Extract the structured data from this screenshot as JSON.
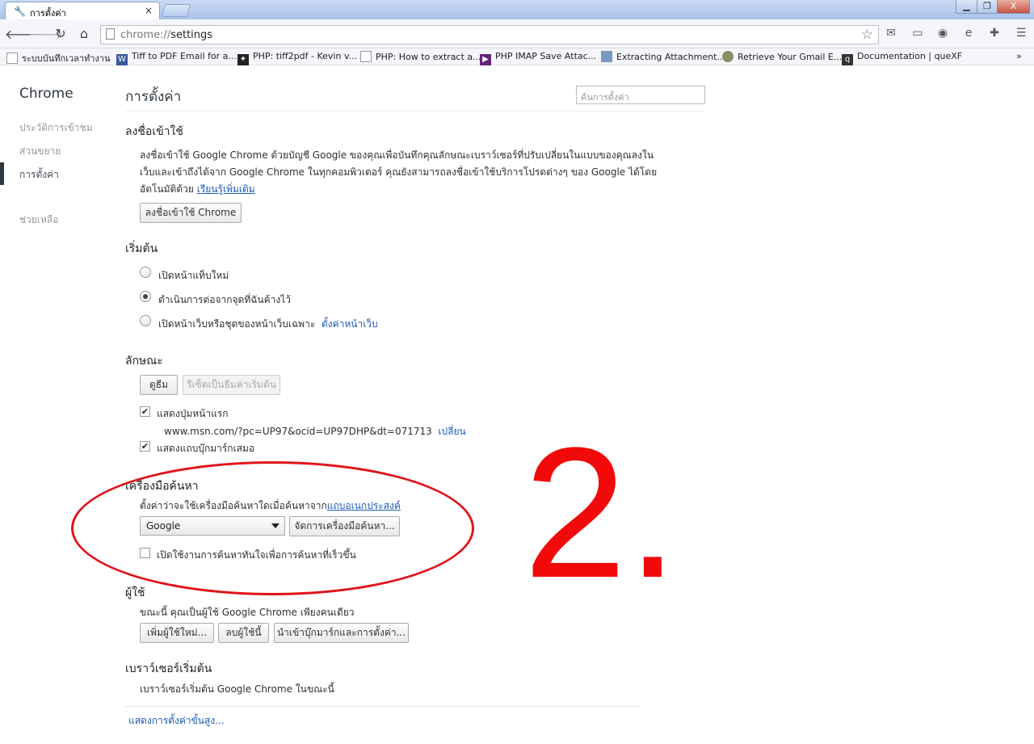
{
  "tab": {
    "title": "การตั้งค่า",
    "close": "×"
  },
  "window_controls": {
    "minimize": "▁",
    "restore": "❐",
    "close": "X"
  },
  "address_bar": {
    "scheme": "chrome://",
    "path": "settings"
  },
  "bookmarks": [
    {
      "label": "ระบบบันทึกเวลาทำงาน",
      "icon": "page-icon"
    },
    {
      "label": "Tiff to PDF Email for a...",
      "icon": "w-icon"
    },
    {
      "label": "PHP: tiff2pdf - Kevin v...",
      "icon": "figure-icon"
    },
    {
      "label": "PHP: How to extract a...",
      "icon": "page-icon"
    },
    {
      "label": "PHP IMAP Save Attac...",
      "icon": "vs-icon"
    },
    {
      "label": "Extracting Attachment...",
      "icon": "blue-square-icon"
    },
    {
      "label": "Retrieve Your Gmail E...",
      "icon": "globe-icon"
    },
    {
      "label": "Documentation | queXF",
      "icon": "quexf-icon"
    }
  ],
  "bookmarks_more": "»",
  "sidebar": {
    "title": "Chrome",
    "items": [
      {
        "label": "ประวัติการเข้าชม"
      },
      {
        "label": "ส่วนขยาย"
      },
      {
        "label": "การตั้งค่า"
      },
      {
        "label": "ช่วยเหลือ"
      }
    ]
  },
  "page": {
    "title": "การตั้งค่า",
    "search_placeholder": "ค้นการตั้งค่า"
  },
  "signin": {
    "heading": "ลงชื่อเข้าใช้",
    "line1": "ลงชื่อเข้าใช้ Google Chrome ด้วยบัญชี Google ของคุณเพื่อบันทึกคุณลักษณะเบราว์เซอร์ที่ปรับเปลี่ยนในแบบของคุณลงใน",
    "line2": "เว็บและเข้าถึงได้จาก Google Chrome ในทุกคอมพิวเตอร์ คุณยังสามารถลงชื่อเข้าใช้บริการโปรดต่างๆ ของ Google ได้โดย",
    "line3": "อัตโนมัติด้วย",
    "learn_more": "เรียนรู้เพิ่มเติม",
    "button": "ลงชื่อเข้าใช้ Chrome"
  },
  "startup": {
    "heading": "เริ่มต้น",
    "options": [
      {
        "label": "เปิดหน้าแท็บใหม่",
        "selected": false
      },
      {
        "label": "ดำเนินการต่อจากจุดที่ฉันค้างไว้",
        "selected": true
      },
      {
        "label": "เปิดหน้าเว็บหรือชุดของหน้าเว็บเฉพาะ",
        "selected": false
      }
    ],
    "set_pages": "ตั้งค่าหน้าเว็บ"
  },
  "appearance": {
    "heading": "ลักษณะ",
    "themes_button": "ดูธีม",
    "reset_theme_button": "รีเซ็ตเป็นธีมค่าเริ่มต้น",
    "show_home": "แสดงปุ่มหน้าแรก",
    "home_url": "www.msn.com/?pc=UP97&ocid=UP97DHP&dt=071713",
    "change": "เปลี่ยน",
    "show_bookmarks": "แสดงแถบบุ๊กมาร์กเสมอ"
  },
  "search": {
    "heading": "เครื่องมือค้นหา",
    "description": "ตั้งค่าว่าจะใช้เครื่องมือค้นหาใดเมื่อค้นหาจาก",
    "omnibox_link": "แถบอเนกประสงค์",
    "engine": "Google",
    "manage_button": "จัดการเครื่องมือค้นหา...",
    "instant": "เปิดใช้งานการค้นหาทันใจเพื่อการค้นหาที่เร็วขึ้น"
  },
  "users": {
    "heading": "ผู้ใช้",
    "description": "ขณะนี้ คุณเป็นผู้ใช้ Google Chrome เพียงคนเดียว",
    "add_button": "เพิ่มผู้ใช้ใหม่...",
    "delete_button": "ลบผู้ใช้นี้",
    "import_button": "นำเข้าบุ๊กมาร์กและการตั้งค่า..."
  },
  "default_browser": {
    "heading": "เบราว์เซอร์เริ่มต้น",
    "description": "เบราว์เซอร์เริ่มต้น Google Chrome ในขณะนี้"
  },
  "advanced_link": "แสดงการตั้งค่าขั้นสูง...",
  "annotation": "2.",
  "colors": {
    "annotation_red": "#e0141b",
    "link_blue": "#1d5ab8"
  }
}
